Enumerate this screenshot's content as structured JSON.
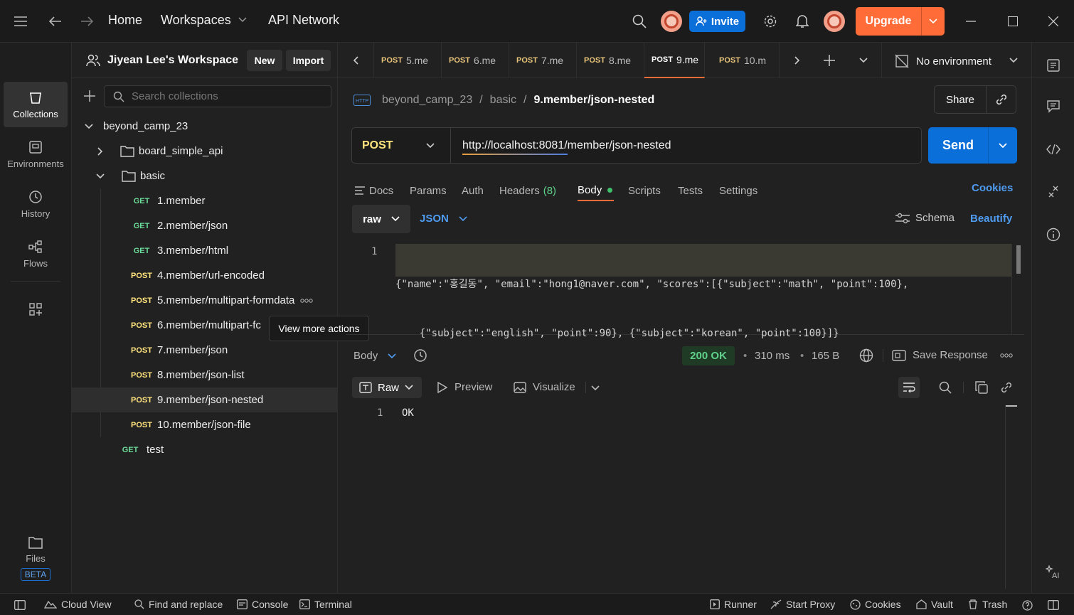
{
  "titlebar": {
    "home": "Home",
    "workspaces": "Workspaces",
    "api_network": "API Network",
    "invite": "Invite",
    "upgrade": "Upgrade"
  },
  "rail": {
    "collections": "Collections",
    "environments": "Environments",
    "history": "History",
    "flows": "Flows",
    "files": "Files",
    "beta": "BETA"
  },
  "sidebar": {
    "workspace_name": "Jiyean Lee's Workspace",
    "new_label": "New",
    "import_label": "Import",
    "search_placeholder": "Search collections",
    "collection": "beyond_camp_23",
    "folders": [
      "board_simple_api",
      "basic"
    ],
    "requests": [
      {
        "method": "GET",
        "name": "1.member"
      },
      {
        "method": "GET",
        "name": "2.member/json"
      },
      {
        "method": "GET",
        "name": "3.member/html"
      },
      {
        "method": "POST",
        "name": "4.member/url-encoded"
      },
      {
        "method": "POST",
        "name": "5.member/multipart-formdata"
      },
      {
        "method": "POST",
        "name": "6.member/multipart-fc"
      },
      {
        "method": "POST",
        "name": "7.member/json"
      },
      {
        "method": "POST",
        "name": "8.member/json-list"
      },
      {
        "method": "POST",
        "name": "9.member/json-nested"
      },
      {
        "method": "POST",
        "name": "10.member/json-file"
      }
    ],
    "root_request": {
      "method": "GET",
      "name": "test"
    },
    "tooltip": "View more actions"
  },
  "tabs": [
    {
      "method": "POST",
      "name": "5.me"
    },
    {
      "method": "POST",
      "name": "6.me"
    },
    {
      "method": "POST",
      "name": "7.me"
    },
    {
      "method": "POST",
      "name": "8.me"
    },
    {
      "method": "POST",
      "name": "9.me"
    },
    {
      "method": "POST",
      "name": "10.m"
    }
  ],
  "environment": "No environment",
  "request": {
    "breadcrumb": [
      "beyond_camp_23",
      "basic",
      "9.member/json-nested"
    ],
    "share": "Share",
    "method": "POST",
    "url": "http://localhost:8081/member/json-nested",
    "send": "Send",
    "subtabs": {
      "docs": "Docs",
      "params": "Params",
      "auth": "Auth",
      "headers": "Headers",
      "headers_count": "(8)",
      "body": "Body",
      "scripts": "Scripts",
      "tests": "Tests",
      "settings": "Settings"
    },
    "cookies": "Cookies",
    "body_mode": "raw",
    "body_format": "JSON",
    "schema": "Schema",
    "beautify": "Beautify",
    "line_number": "1",
    "code_line1": "{\"name\":\"홍길동\", \"email\":\"hong1@naver.com\", \"scores\":[{\"subject\":\"math\", \"point\":100},",
    "code_line2": "    {\"subject\":\"english\", \"point\":90}, {\"subject\":\"korean\", \"point\":100}]}"
  },
  "response": {
    "body_label": "Body",
    "status": "200 OK",
    "time": "310 ms",
    "size": "165 B",
    "save": "Save Response",
    "raw": "Raw",
    "preview": "Preview",
    "visualize": "Visualize",
    "line_number": "1",
    "content": "OK"
  },
  "statusbar": {
    "cloud_view": "Cloud View",
    "find_replace": "Find and replace",
    "console": "Console",
    "terminal": "Terminal",
    "runner": "Runner",
    "start_proxy": "Start Proxy",
    "cookies": "Cookies",
    "vault": "Vault",
    "trash": "Trash"
  },
  "colors": {
    "accent": "#ff6c37",
    "primary": "#0b6fd9",
    "get": "#6bdd9a",
    "post": "#ffe47e",
    "status_ok": "#5fd18b"
  }
}
